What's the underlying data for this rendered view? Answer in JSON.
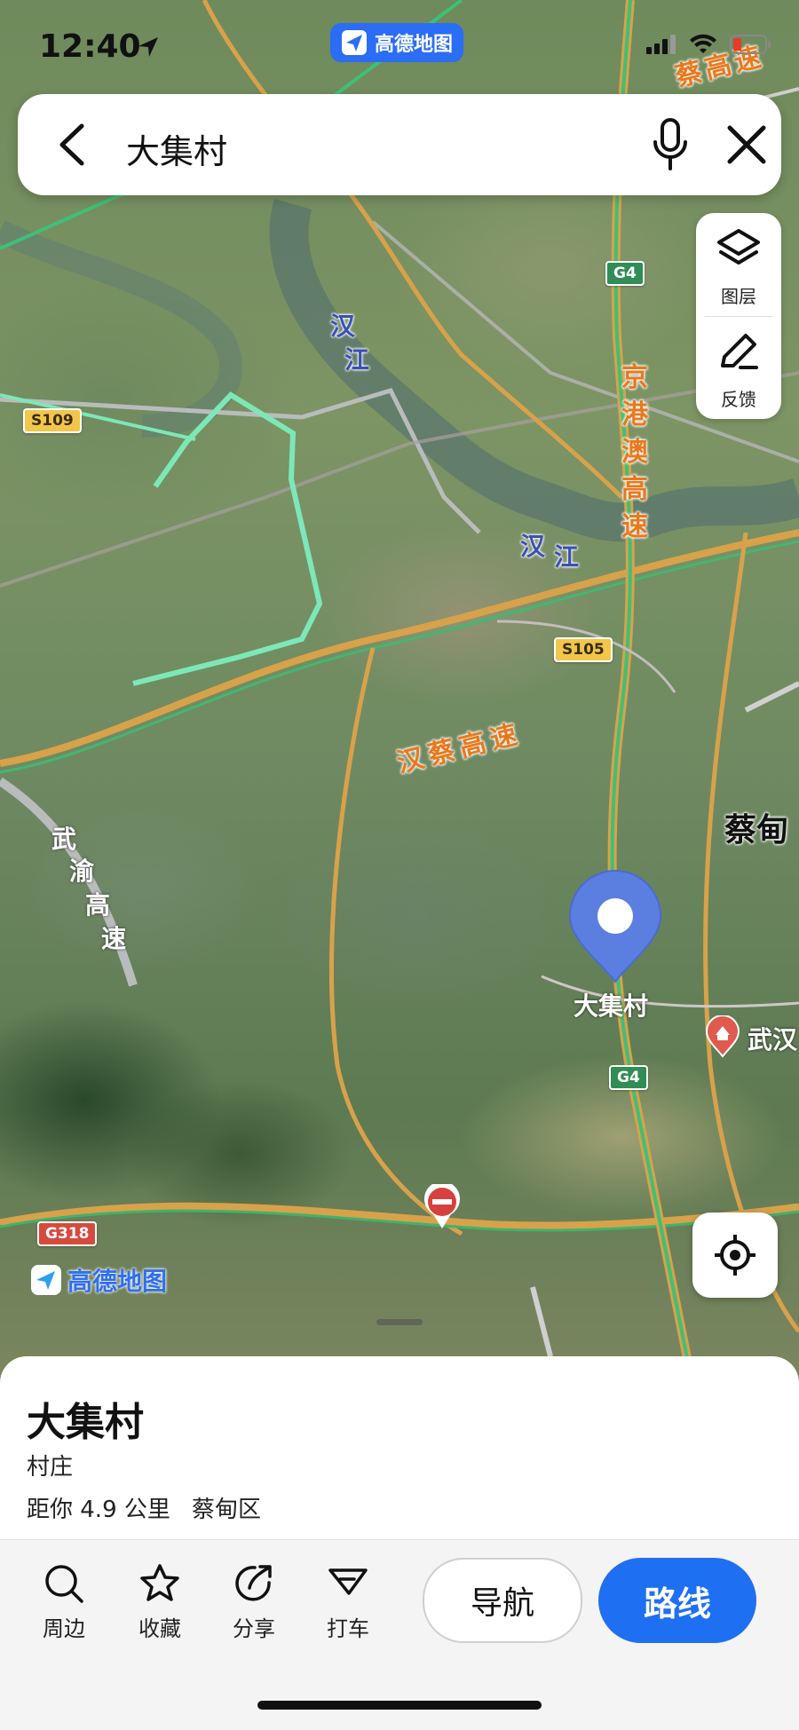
{
  "status_bar": {
    "time": "12:40",
    "location_icon": "location-arrow-icon",
    "app_badge": "高德地图"
  },
  "search": {
    "query": "大集村",
    "back_icon": "chevron-left-icon",
    "mic_icon": "microphone-icon",
    "clear_icon": "close-icon"
  },
  "tools": {
    "layers_label": "图层",
    "feedback_label": "反馈"
  },
  "map": {
    "watermark": "高德地图",
    "rivers": [
      "汉",
      "江",
      "汉",
      "江"
    ],
    "highways": {
      "jinggangao": [
        "京",
        "港",
        "澳",
        "高",
        "速"
      ],
      "hancai": "汉蔡高速",
      "wuyu": [
        "武",
        "渝",
        "高",
        "速"
      ],
      "top_right": "蔡高速"
    },
    "shields": {
      "g4_top": "G4",
      "g4_bottom": "G4",
      "s109": "S109",
      "s105": "S105",
      "g318": "G318"
    },
    "district_label": "蔡甸",
    "pin_label": "大集村",
    "poi_label": "武汉",
    "colors": {
      "road_green": "#38b86a",
      "road_orange": "#d9a54a",
      "pin_blue": "#5b7fe0",
      "brand_blue": "#2b6df5"
    }
  },
  "place": {
    "name": "大集村",
    "type": "村庄",
    "distance": "距你 4.9 公里",
    "district": "蔡甸区"
  },
  "actions": {
    "nearby": "周边",
    "favorite": "收藏",
    "share": "分享",
    "taxi": "打车",
    "navigate": "导航",
    "route": "路线"
  }
}
